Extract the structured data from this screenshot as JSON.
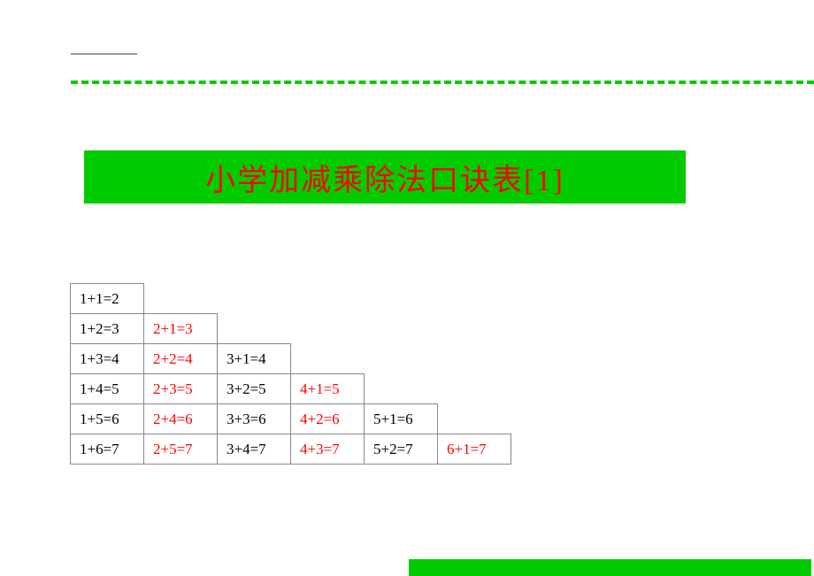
{
  "title": "小学加减乘除法口诀表[1]",
  "rows": [
    [
      {
        "text": "1+1=2",
        "color": "black"
      }
    ],
    [
      {
        "text": "1+2=3",
        "color": "black"
      },
      {
        "text": "2+1=3",
        "color": "red"
      }
    ],
    [
      {
        "text": "1+3=4",
        "color": "black"
      },
      {
        "text": "2+2=4",
        "color": "red"
      },
      {
        "text": "3+1=4",
        "color": "black"
      }
    ],
    [
      {
        "text": "1+4=5",
        "color": "black"
      },
      {
        "text": "2+3=5",
        "color": "red"
      },
      {
        "text": "3+2=5",
        "color": "black"
      },
      {
        "text": "4+1=5",
        "color": "red"
      }
    ],
    [
      {
        "text": "1+5=6",
        "color": "black"
      },
      {
        "text": "2+4=6",
        "color": "red"
      },
      {
        "text": "3+3=6",
        "color": "black"
      },
      {
        "text": "4+2=6",
        "color": "red"
      },
      {
        "text": "5+1=6",
        "color": "black"
      }
    ],
    [
      {
        "text": "1+6=7",
        "color": "black"
      },
      {
        "text": "2+5=7",
        "color": "red"
      },
      {
        "text": "3+4=7",
        "color": "black"
      },
      {
        "text": "4+3=7",
        "color": "red"
      },
      {
        "text": "5+2=7",
        "color": "black"
      },
      {
        "text": "6+1=7",
        "color": "red"
      }
    ]
  ]
}
